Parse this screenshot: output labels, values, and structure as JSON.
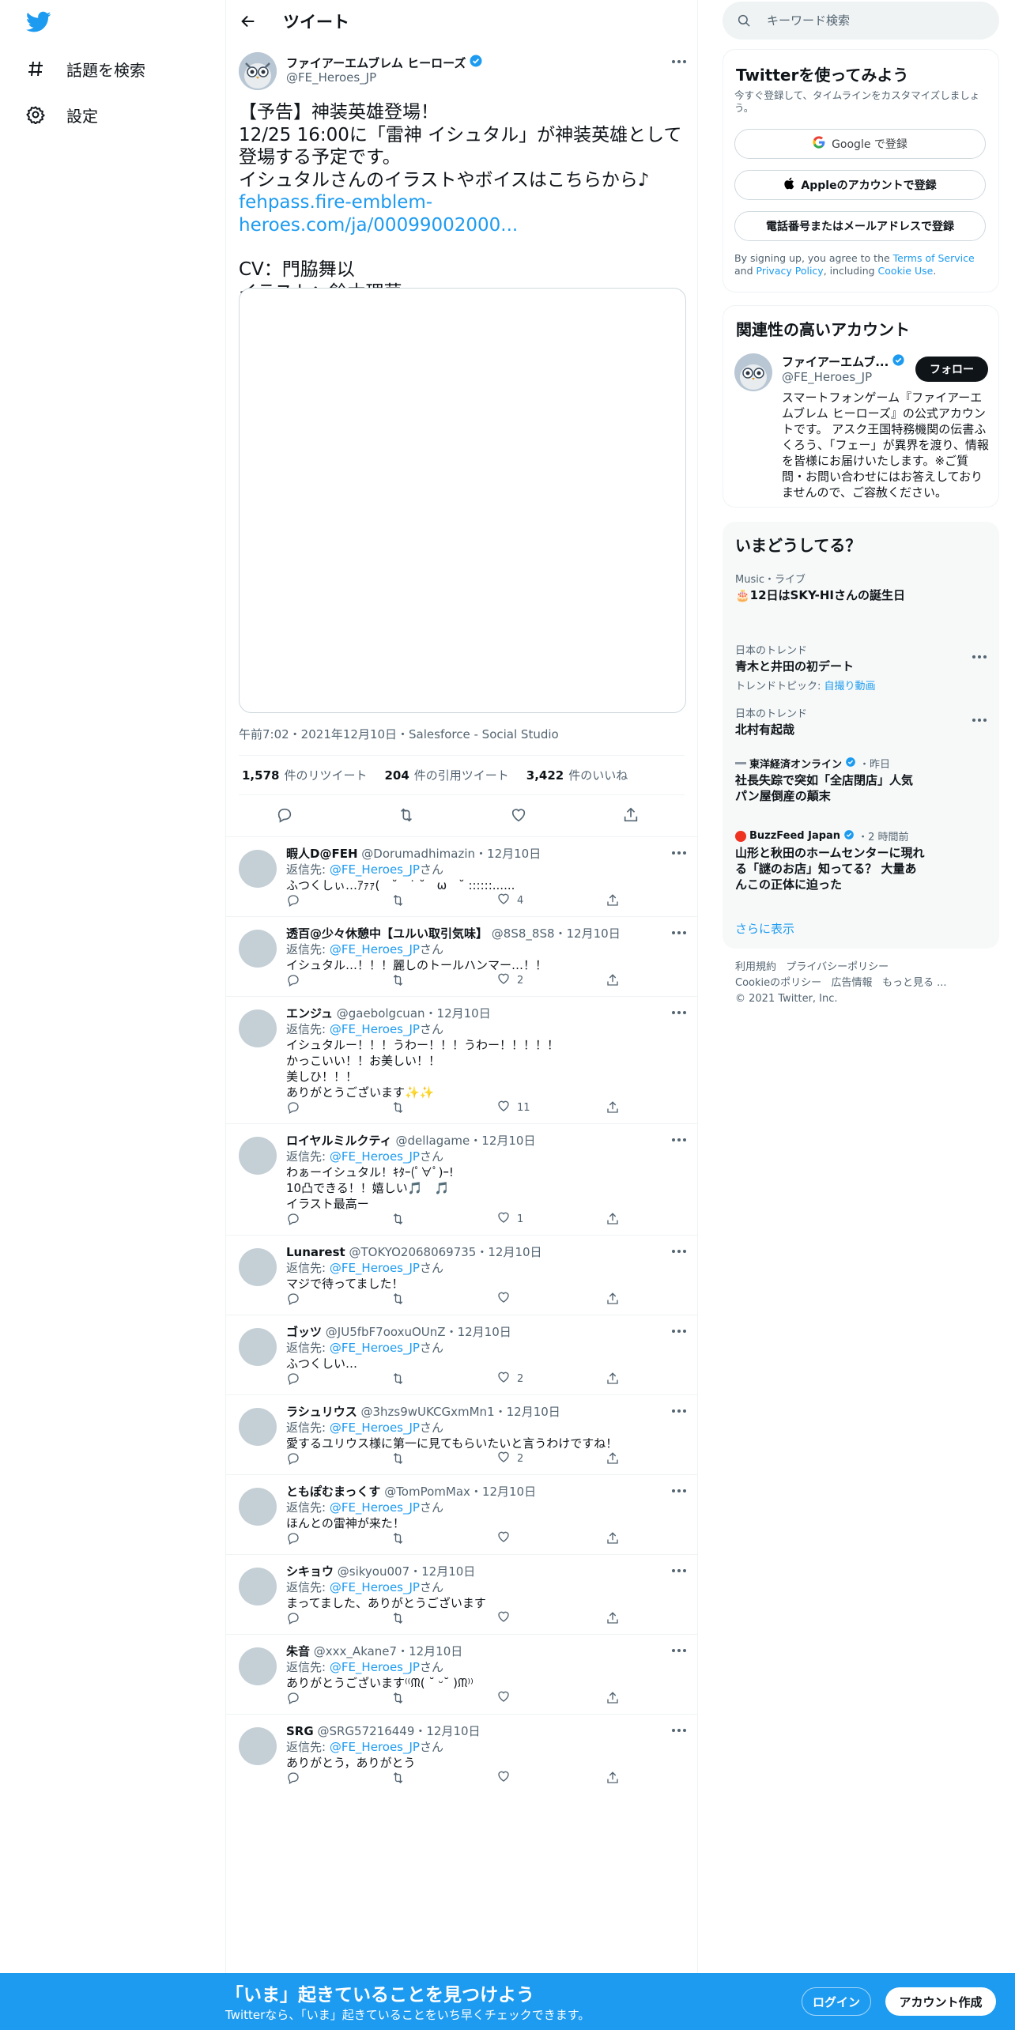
{
  "nav": {
    "explore_label": "話題を検索",
    "settings_label": "設定"
  },
  "header": {
    "title": "ツイート"
  },
  "main_tweet": {
    "name": "ファイアーエムブレム ヒーローズ",
    "handle": "@FE_Heroes_JP",
    "line1": "【予告】神装英雄登場！",
    "line2": "12/25 16:00に「雷神 イシュタル」が神装英雄として",
    "line3": "登場する予定です。",
    "line4": "イシュタルさんのイラストやボイスはこちらから♪",
    "link": "fehpass.fire-emblem-heroes.com/ja/00099002000...",
    "line5": "CV：門脇舞以",
    "line6": "イラスト：鈴木理華",
    "meta": "午前7:02・2021年12月10日・Salesforce - Social Studio",
    "retweets_count": "1,578",
    "retweets_label": "件のリツイート",
    "quotes_count": "204",
    "quotes_label": "件の引用ツイート",
    "likes_count": "3,422",
    "likes_label": "件のいいね"
  },
  "reply_prefix": "返信先: ",
  "reply_target": "@FE_Heroes_JP",
  "reply_suffix": "さん",
  "replies": [
    {
      "name": "暇人D@FEH",
      "handle": "@Dorumadhimazin",
      "date": "・12月10日",
      "text": "ふつくしぃ…ｱｧｧ(　˘　˙ ˘　ω　˘ ::::::......",
      "likes": "4"
    },
    {
      "name": "透百@少々休憩中【ユルい取引気味】",
      "handle": "@8S8_8S8",
      "date": "・12月10日",
      "text": "イシュタル…！！！麗しのトールハンマー…！！",
      "likes": "2"
    },
    {
      "name": "エンジュ",
      "handle": "@gaebolgcuan",
      "date": "・12月10日",
      "text": "イシュタルー！！！うわー！！！うわー！！！！！\nかっこいい！！お美しい！！\n美しひ！！！\nありがとうございます✨✨",
      "likes": "11"
    },
    {
      "name": "ロイヤルミルクティ",
      "handle": "@dellagame",
      "date": "・12月10日",
      "text": "わぁーイシュタル！ｷﾀｰ(ﾟ∀ﾟ)ｰ!\n10凸できる！！嬉しい🎵　🎵\nイラスト最高ー",
      "likes": "1"
    },
    {
      "name": "Lunarest",
      "handle": "@TOKYO2068069735",
      "date": "・12月10日",
      "text": "マジで待ってました！",
      "likes": ""
    },
    {
      "name": "ゴッツ",
      "handle": "@JU5fbF7ooxuOUnZ",
      "date": "・12月10日",
      "text": "ふつくしい…",
      "likes": "2"
    },
    {
      "name": "ラシュリウス",
      "handle": "@3hzs9wUKCGxmMn1",
      "date": "・12月10日",
      "text": "愛するユリウス様に第一に見てもらいたいと言うわけですね！",
      "likes": "2"
    },
    {
      "name": "ともぽむまっくす",
      "handle": "@TomPomMax",
      "date": "・12月10日",
      "text": "ほんとの雷神が来た！",
      "likes": ""
    },
    {
      "name": "シキョウ",
      "handle": "@sikyou007",
      "date": "・12月10日",
      "text": "まってました、ありがとうございます",
      "likes": ""
    },
    {
      "name": "朱音",
      "handle": "@xxx_Akane7",
      "date": "・12月10日",
      "text": "ありがとうございます⁽⁽ᙏ( ˘ ᵕ˘ )ᙏ⁾⁾",
      "likes": ""
    },
    {
      "name": "SRG",
      "handle": "@SRG57216449",
      "date": "・12月10日",
      "text": "ありがとう，ありがとう",
      "likes": ""
    }
  ],
  "search": {
    "placeholder": "キーワード検索"
  },
  "signup_card": {
    "title": "Twitterを使ってみよう",
    "desc": "今すぐ登録して、タイムラインをカスタマイズしましょう。",
    "google": "Google で登録",
    "apple": "Appleのアカウントで登録",
    "phone": "電話番号またはメールアドレスで登録",
    "terms_a": "By signing up, you agree to the ",
    "terms_link": "Terms of Service",
    "terms_b": " and ",
    "privacy_link": "Privacy Policy",
    "terms_c": ", including ",
    "cookie_link": "Cookie Use",
    "terms_d": "."
  },
  "related": {
    "title": "関連性の高いアカウント",
    "name": "ファイアーエムブ...",
    "handle": "@FE_Heroes_JP",
    "follow": "フォロー",
    "bio": "スマートフォンゲーム『ファイアーエムブレム ヒーローズ』の公式アカウントです。 アスク王国特務機関の伝書ふくろう、「フェー」が異界を渡り、情報を皆様にお届けいたします。※ご質問・お問い合わせにはお答えしておりませんので、ご容赦ください。"
  },
  "trends": {
    "title": "いまどうしてる？",
    "t1_cat": "Music・ライブ",
    "t1_title": "🎂12日はSKY-HIさんの誕生日",
    "t2_cat": "日本のトレンド",
    "t2_title": "青木と井田の初デート",
    "t2_sub_label": "トレンドトピック: ",
    "t2_sub_link": "自撮り動画",
    "t3_cat": "日本のトレンド",
    "t3_title": "北村有起哉",
    "t4_src": "東洋経済オンライン",
    "t4_time": "・昨日",
    "t4_title": "社長失踪で突如「全店閉店」人気パン屋倒産の顛末",
    "t5_src": "BuzzFeed Japan",
    "t5_time": "・2 時間前",
    "t5_title": "山形と秋田のホームセンターに現れる「謎のお店」知ってる？ 大量あんこの正体に迫った",
    "show_more": "さらに表示"
  },
  "footer": {
    "terms": "利用規約",
    "privacy": "プライバシーポリシー",
    "cookie": "Cookieのポリシー",
    "ads": "広告情報",
    "more": "もっと見る ...",
    "copyright": "© 2021 Twitter, Inc."
  },
  "bottom_bar": {
    "title": "「いま」起きていることを見つけよう",
    "subtitle": "Twitterなら、「いま」起きていることをいち早くチェックできます。",
    "login": "ログイン",
    "signup": "アカウント作成"
  },
  "colors": {
    "accent": "#1d9bf0",
    "text": "#0f1419",
    "muted": "#536471"
  }
}
